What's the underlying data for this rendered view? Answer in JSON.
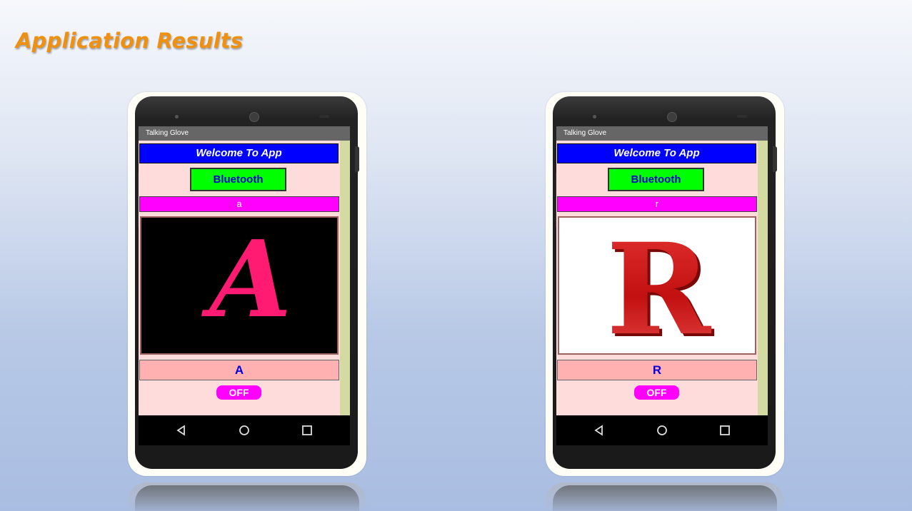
{
  "slide": {
    "title": "Application Results"
  },
  "phones": [
    {
      "app_title": "Talking Glove",
      "welcome": "Welcome To App",
      "bluetooth_label": "Bluetooth",
      "received_char": "a",
      "image_letter": "A",
      "letter_label": "A",
      "off_label": "OFF"
    },
    {
      "app_title": "Talking Glove",
      "welcome": "Welcome To App",
      "bluetooth_label": "Bluetooth",
      "received_char": "r",
      "image_letter": "R",
      "letter_label": "R",
      "off_label": "OFF"
    }
  ],
  "colors": {
    "title": "#f0900f",
    "welcome_bg": "#0000ff",
    "bluetooth_bg": "#00ff00",
    "received_bg": "#ff00ff",
    "letter_label_bg": "#ffb0b0",
    "off_bg": "#ff00ff",
    "app_bg": "#ffdcdc",
    "letter_a_color": "#ff1a72",
    "letter_r_color": "#c81414"
  },
  "icons": {
    "nav_back": "back-triangle-icon",
    "nav_home": "home-circle-icon",
    "nav_recent": "recent-square-icon"
  }
}
